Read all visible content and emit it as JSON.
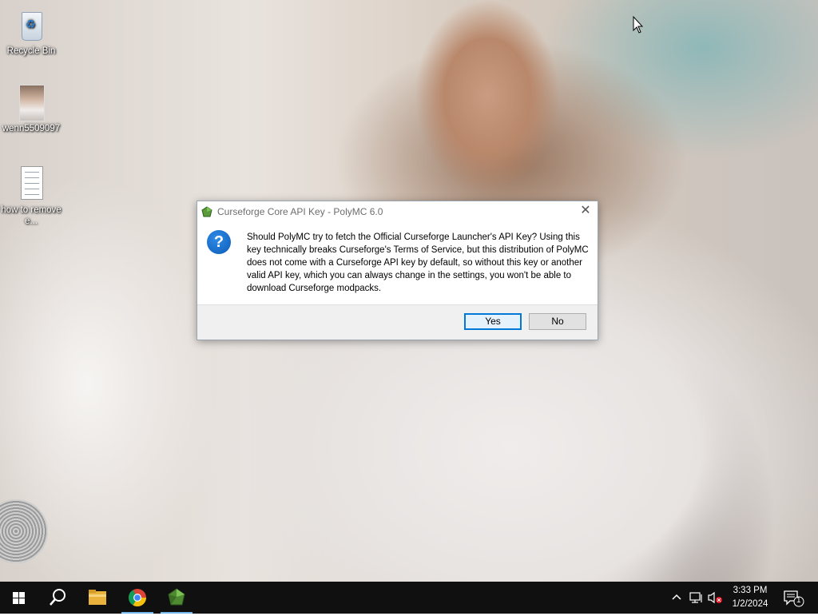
{
  "desktop": {
    "icons": [
      {
        "label": "Recycle Bin",
        "icon": "recycle-bin-icon"
      },
      {
        "label": "wenn5509097",
        "icon": "image-file-icon"
      },
      {
        "label": "how to remove e...",
        "icon": "text-file-icon"
      }
    ]
  },
  "dialog": {
    "title": "Curseforge Core API Key - PolyMC 6.0",
    "icon": "question-icon",
    "message": "Should PolyMC try to fetch the Official Curseforge Launcher's API Key? Using this key technically breaks Curseforge's Terms of Service, but this distribution of PolyMC does not come with a Curseforge API key by default, so without this key or another valid API key, which you can always change in the settings, you won't be able to download Curseforge modpacks.",
    "buttons": {
      "yes": "Yes",
      "no": "No"
    }
  },
  "taskbar": {
    "items": [
      "start-icon",
      "search-icon",
      "file-explorer-icon",
      "chrome-icon",
      "polymc-icon"
    ],
    "clock": {
      "time": "3:33 PM",
      "date": "1/2/2024"
    },
    "notification_count": "1"
  },
  "colors": {
    "taskbar": "#101010",
    "accent": "#0078d7",
    "dialog_footer": "#f0f0f0",
    "running_indicator": "#76b9ed"
  }
}
